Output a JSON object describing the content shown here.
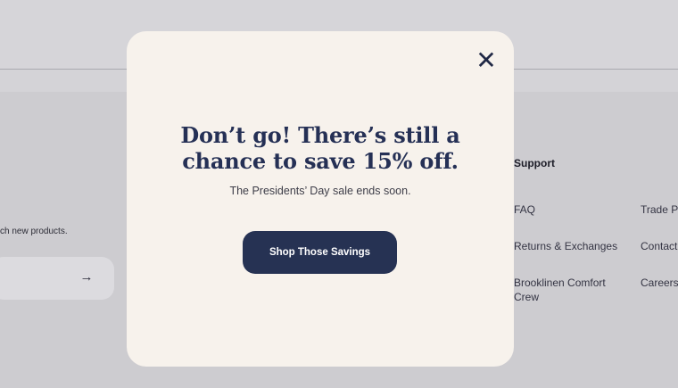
{
  "footer": {
    "newsletter_text": "ch new products.",
    "submit_arrow": "→",
    "support_heading": "Support",
    "links": [
      "FAQ",
      "Returns & Exchanges",
      "Brooklinen Comfort Crew",
      "Trade Pr",
      "Contact",
      "Careers"
    ]
  },
  "modal": {
    "close_glyph": "✕",
    "headline_line1": "Don’t go! There’s still a",
    "headline_line2": "chance to save 15% off.",
    "subtext": "The Presidents’ Day sale ends soon.",
    "cta_label": "Shop Those Savings"
  },
  "colors": {
    "modal_bg": "#f7f2ec",
    "brand_navy": "#263253",
    "overlay": "#cdccd0"
  }
}
